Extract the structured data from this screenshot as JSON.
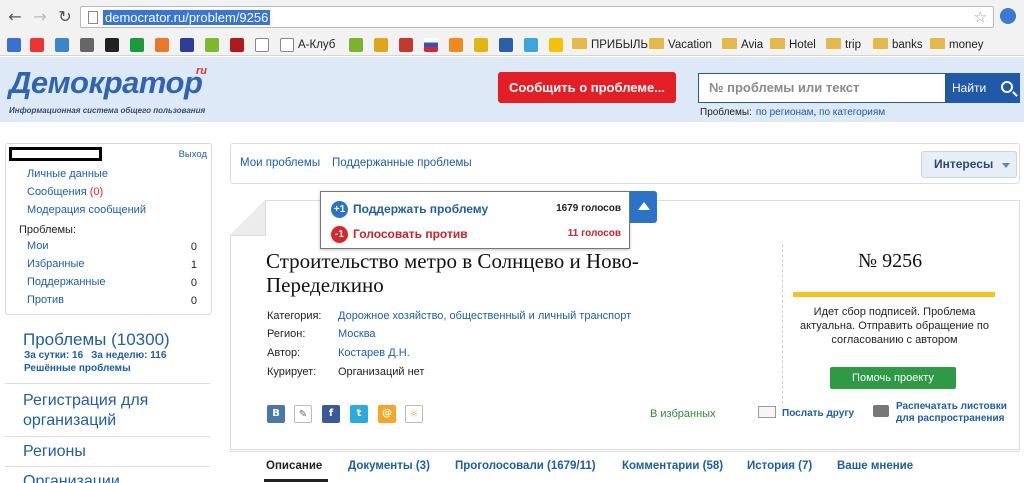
{
  "browser": {
    "url": "democrator.ru/problem/9256",
    "bookmarks": [
      "А-Клуб",
      "ПРИБЫЛЬ",
      "Vacation",
      "Avia",
      "Hotel",
      "trip",
      "banks",
      "money"
    ]
  },
  "header": {
    "logo": "Демократор",
    "logo_sup": "ru",
    "tagline": "Информационная система общего пользования",
    "report_button": "Сообщить о проблеме...",
    "search_placeholder": "№ проблемы или текст",
    "search_button": "Найти",
    "search_hint_label": "Проблемы:",
    "search_hint_regions": "по регионам",
    "search_hint_categories": "по категориям"
  },
  "sidebar": {
    "logout": "Выход",
    "links": [
      "Личные данные",
      "Сообщения",
      "Модерация сообщений"
    ],
    "messages_count": "(0)",
    "problems_label": "Проблемы:",
    "problem_rows": [
      {
        "label": "Мои",
        "count": "0"
      },
      {
        "label": "Избранные",
        "count": "1"
      },
      {
        "label": "Поддержанные",
        "count": "0"
      },
      {
        "label": "Против",
        "count": "0"
      }
    ],
    "problems_title": "Проблемы (10300)",
    "per_day": "За сутки: 16",
    "per_week": "За неделю: 116",
    "solved": "Решённые проблемы",
    "org_registration": "Регистрация для организаций",
    "regions": "Регионы",
    "organizations": "Организации"
  },
  "top_tabs": {
    "my_problems": "Мои проблемы",
    "supported_problems": "Поддержанные проблемы",
    "interests": "Интересы"
  },
  "votes": {
    "support_label": "Поддержать проблему",
    "support_count": "1679 голосов",
    "against_label": "Голосовать против",
    "against_count": "11 голосов",
    "support_icon": "+1",
    "against_icon": "-1"
  },
  "problem": {
    "title": "Строительство метро в Солнцево и Ново-Переделкино",
    "number": "№ 9256",
    "meta": [
      {
        "label": "Категория:",
        "value": "Дорожное хозяйство, общественный и личный транспорт"
      },
      {
        "label": "Регион:",
        "value": "Москва"
      },
      {
        "label": "Автор:",
        "value": "Костарев Д.Н."
      },
      {
        "label": "Курирует:",
        "value": "Организаций нет"
      }
    ],
    "status": "Идет сбор подписей. Проблема актуальна. Отправить обращение по согласованию с автором",
    "progress": 1.0,
    "help_button": "Помочь проекту",
    "favorites": "В избранных",
    "send_friend": "Послать другу",
    "print_line1": "Распечатать листовки",
    "print_line2": "для распространения"
  },
  "bottom_tabs": [
    "Описание",
    "Документы (3)",
    "Проголосовали (1679/11)",
    "Комментарии (58)",
    "История (7)",
    "Ваше мнение"
  ],
  "colors": {
    "brand_blue": "#2f64b1",
    "report_red": "#e31e24",
    "help_green": "#2e9a46",
    "progress_yellow": "#f5c21d"
  }
}
